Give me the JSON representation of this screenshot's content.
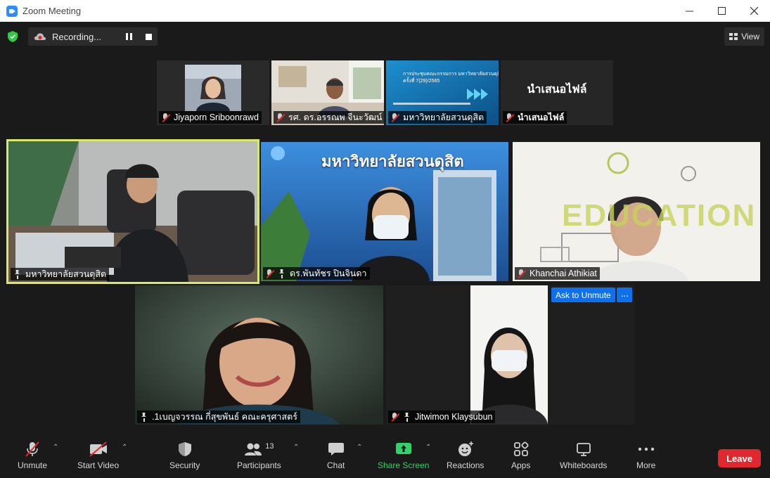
{
  "window": {
    "title": "Zoom Meeting"
  },
  "topbar": {
    "recording_label": "Recording...",
    "view_label": "View"
  },
  "thumbnails": [
    {
      "name": "Jiyaporn Sriboonrawd",
      "muted": true
    },
    {
      "name": "รศ. ดร.อรรณพ จีนะวัฒน์",
      "muted": true
    },
    {
      "name": "มหาวิทยาลัยสวนดุสิต",
      "muted": true,
      "slide_title": "การประชุมคณะกรรมการ มหาวิทยาลัยสวนดุสิต",
      "slide_sub": "ครั้งที่ 7(29)/2565"
    },
    {
      "name": "นำเสนอไฟล์",
      "muted": true,
      "display_text": "นำเสนอไฟล์"
    }
  ],
  "gallery": [
    {
      "name": "มหาวิทยาลัยสวนดุสิต",
      "pinned": true,
      "muted": false,
      "active": true
    },
    {
      "name": "ดร.พันทัชร ปินจินดา",
      "pinned": true,
      "muted": true,
      "banner": "มหาวิทยาลัยสวนดุสิต"
    },
    {
      "name": "Khanchai Athikiat",
      "pinned": false,
      "muted": true,
      "banner": "EDUCATION"
    },
    {
      "name": ".1เบญจวรรณ กี่สุขพันธ์ คณะครุศาสตร์",
      "pinned": true,
      "muted": false
    },
    {
      "name": "Jitwimon Klaysubun",
      "pinned": true,
      "muted": true
    }
  ],
  "overlay": {
    "ask_to_unmute": "Ask to Unmute",
    "more": "···"
  },
  "toolbar": {
    "unmute": "Unmute",
    "start_video": "Start Video",
    "security": "Security",
    "participants": "Participants",
    "participants_count": "13",
    "chat": "Chat",
    "share_screen": "Share Screen",
    "reactions": "Reactions",
    "apps": "Apps",
    "whiteboards": "Whiteboards",
    "more": "More",
    "leave": "Leave"
  },
  "colors": {
    "accent_blue": "#0e71eb",
    "share_green": "#33d16a",
    "leave_red": "#e0282e",
    "active_speaker": "#d7e86a"
  }
}
